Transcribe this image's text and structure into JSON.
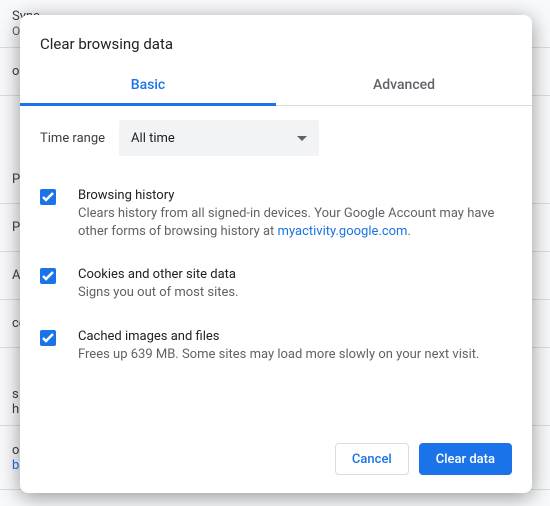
{
  "background": {
    "sync_label": "Sync",
    "sync_status": "On"
  },
  "dialog": {
    "title": "Clear browsing data",
    "tabs": {
      "basic": "Basic",
      "advanced": "Advanced"
    },
    "time_range": {
      "label": "Time range",
      "value": "All time"
    },
    "options": {
      "browsing_history": {
        "title": "Browsing history",
        "desc_prefix": "Clears history from all signed-in devices. Your Google Account may have other forms of browsing history at ",
        "link_text": "myactivity.google.com",
        "desc_suffix": ".",
        "checked": true
      },
      "cookies": {
        "title": "Cookies and other site data",
        "desc": "Signs you out of most sites.",
        "checked": true
      },
      "cache": {
        "title": "Cached images and files",
        "desc": "Frees up 639 MB. Some sites may load more slowly on your next visit.",
        "checked": true
      }
    },
    "buttons": {
      "cancel": "Cancel",
      "clear": "Clear data"
    }
  }
}
